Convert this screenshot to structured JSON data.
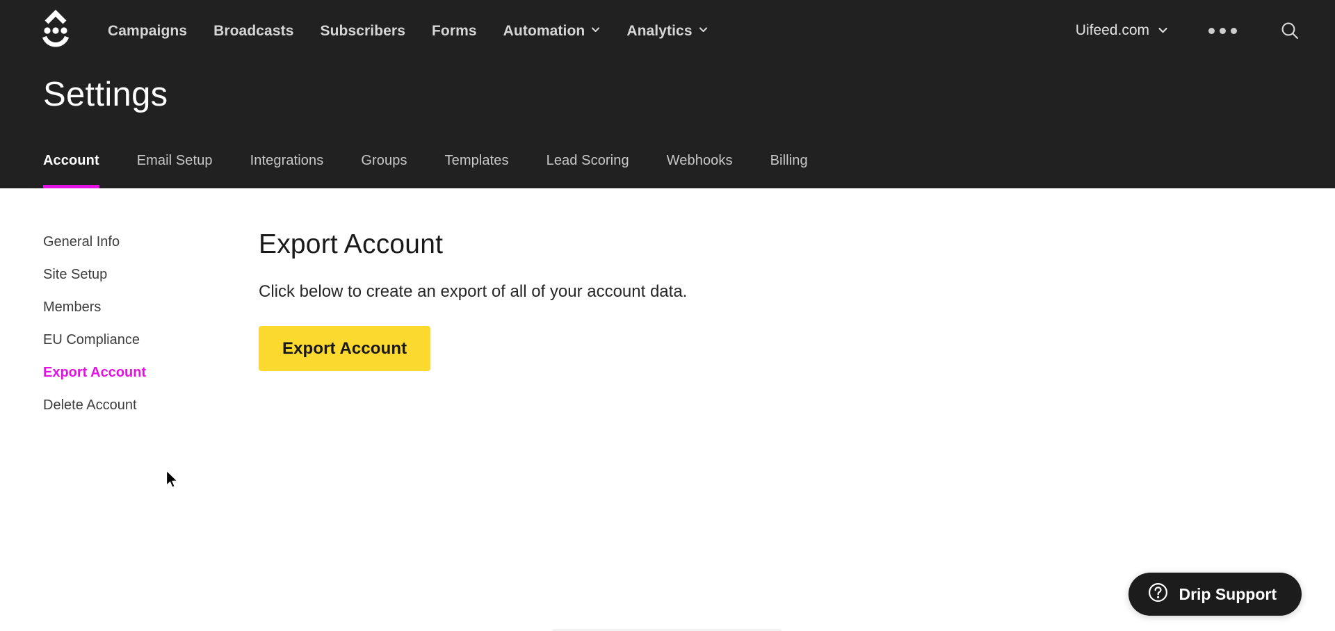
{
  "brand": {
    "logo_name": "drip-logo",
    "accent_magenta": "#e312e3",
    "accent_yellow": "#fbd92f",
    "header_bg": "#212121",
    "page_bg": "#ffffff"
  },
  "topnav": {
    "links": [
      {
        "label": "Campaigns",
        "has_dropdown": false
      },
      {
        "label": "Broadcasts",
        "has_dropdown": false
      },
      {
        "label": "Subscribers",
        "has_dropdown": false
      },
      {
        "label": "Forms",
        "has_dropdown": false
      },
      {
        "label": "Automation",
        "has_dropdown": true
      },
      {
        "label": "Analytics",
        "has_dropdown": true
      }
    ],
    "account": {
      "label": "Uifeed.com",
      "icon": "chevron-down-icon"
    },
    "overflow_menu_icon": "ellipsis-icon",
    "search_icon": "search-icon"
  },
  "header": {
    "title": "Settings"
  },
  "tabs": [
    {
      "label": "Account",
      "active": true
    },
    {
      "label": "Email Setup",
      "active": false
    },
    {
      "label": "Integrations",
      "active": false
    },
    {
      "label": "Groups",
      "active": false
    },
    {
      "label": "Templates",
      "active": false
    },
    {
      "label": "Lead Scoring",
      "active": false
    },
    {
      "label": "Webhooks",
      "active": false
    },
    {
      "label": "Billing",
      "active": false
    }
  ],
  "sidebar": {
    "items": [
      {
        "label": "General Info",
        "active": false
      },
      {
        "label": "Site Setup",
        "active": false
      },
      {
        "label": "Members",
        "active": false
      },
      {
        "label": "EU Compliance",
        "active": false
      },
      {
        "label": "Export Account",
        "active": true
      },
      {
        "label": "Delete Account",
        "active": false
      }
    ]
  },
  "main": {
    "title": "Export Account",
    "description": "Click below to create an export of all of your account data.",
    "export_button_label": "Export Account"
  },
  "support": {
    "label": "Drip Support",
    "icon": "question-circle-icon"
  }
}
